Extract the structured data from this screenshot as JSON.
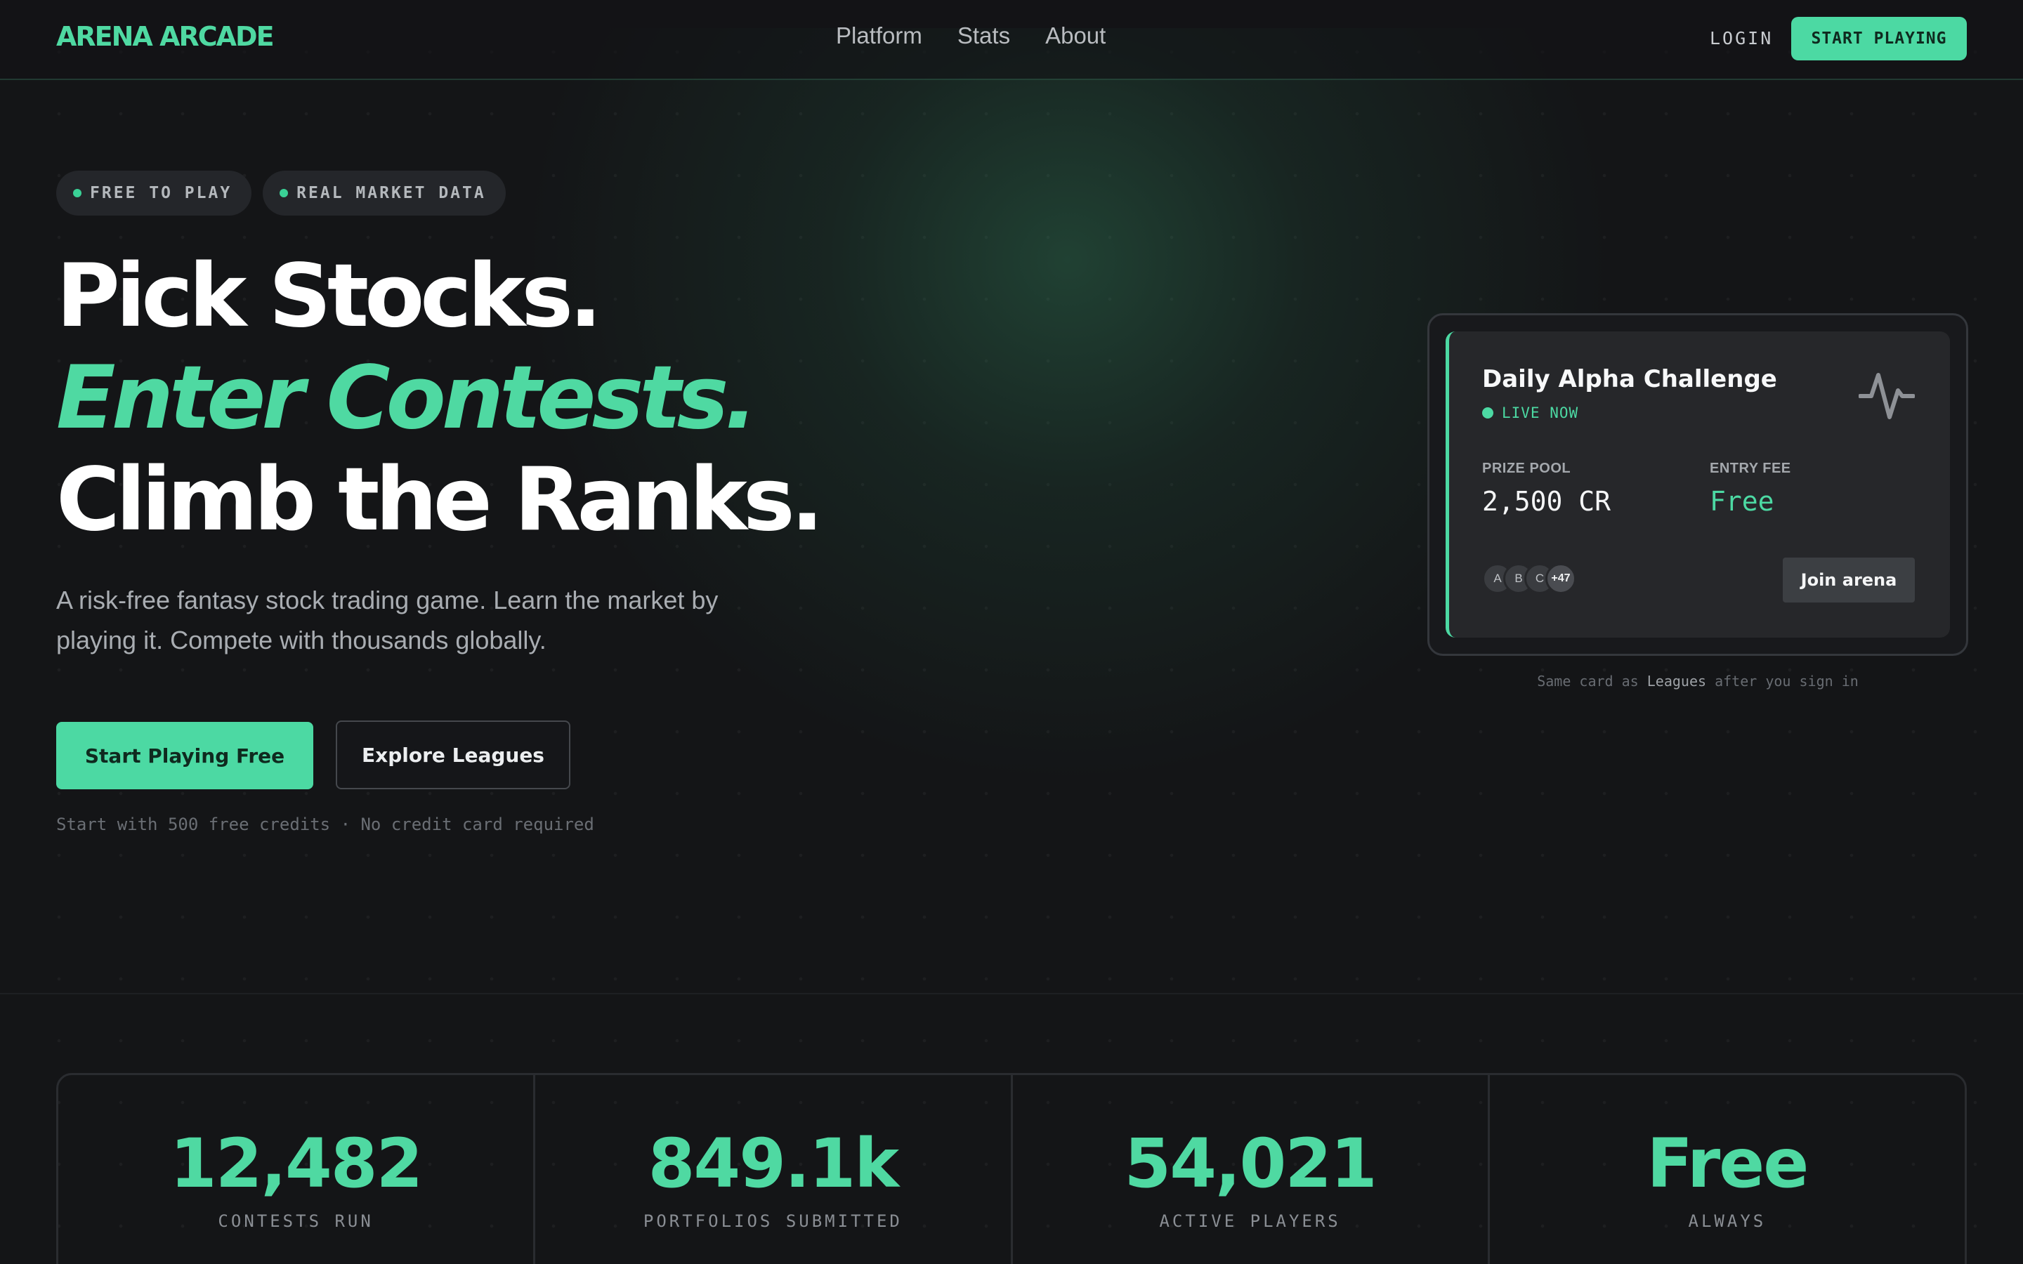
{
  "nav": {
    "brand": "ARENA ARCADE",
    "links": [
      "Platform",
      "Stats",
      "About"
    ],
    "login": "LOGIN",
    "start": "START PLAYING"
  },
  "hero": {
    "badges": [
      "FREE TO PLAY",
      "REAL MARKET DATA"
    ],
    "headline": [
      "Pick Stocks.",
      "Enter Contests.",
      "Climb the Ranks."
    ],
    "lead": "A risk-free fantasy stock trading game. Learn the market by playing it. Compete with thousands globally.",
    "cta_primary": "Start Playing Free",
    "cta_secondary": "Explore Leagues",
    "fine_print": "Start with 500 free credits · No credit card required"
  },
  "card": {
    "title": "Daily Alpha Challenge",
    "status": "LIVE NOW",
    "prize_label": "PRIZE POOL",
    "prize_value": "2,500 CR",
    "fee_label": "ENTRY FEE",
    "fee_value": "Free",
    "avatars": [
      "A",
      "B",
      "C",
      "+47"
    ],
    "join": "Join arena",
    "note_before": "Same card as",
    "note_em": "Leagues",
    "note_after": "after you sign in",
    "accent": "#4cd9a3"
  },
  "stats": [
    {
      "value": "12,482",
      "label": "CONTESTS RUN"
    },
    {
      "value": "849.1k",
      "label": "PORTFOLIOS SUBMITTED"
    },
    {
      "value": "54,021",
      "label": "ACTIVE PLAYERS"
    },
    {
      "value": "Free",
      "label": "ALWAYS"
    }
  ]
}
